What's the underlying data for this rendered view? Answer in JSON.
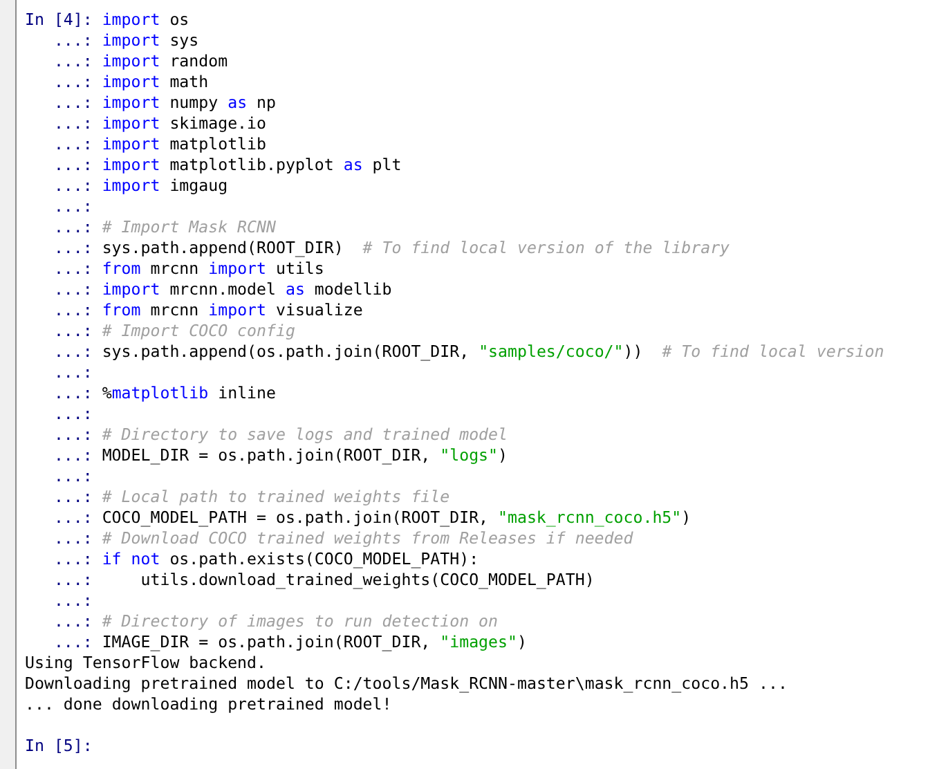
{
  "console": {
    "lines": [
      {
        "prompt": "In [4]:",
        "tokens": [
          {
            "kind": "keyword",
            "text": "import"
          },
          {
            "kind": "plain",
            "text": " os"
          }
        ]
      },
      {
        "prompt": "...:",
        "tokens": [
          {
            "kind": "keyword",
            "text": "import"
          },
          {
            "kind": "plain",
            "text": " sys"
          }
        ]
      },
      {
        "prompt": "...:",
        "tokens": [
          {
            "kind": "keyword",
            "text": "import"
          },
          {
            "kind": "plain",
            "text": " random"
          }
        ]
      },
      {
        "prompt": "...:",
        "tokens": [
          {
            "kind": "keyword",
            "text": "import"
          },
          {
            "kind": "plain",
            "text": " math"
          }
        ]
      },
      {
        "prompt": "...:",
        "tokens": [
          {
            "kind": "keyword",
            "text": "import"
          },
          {
            "kind": "plain",
            "text": " numpy "
          },
          {
            "kind": "keyword",
            "text": "as"
          },
          {
            "kind": "plain",
            "text": " np"
          }
        ]
      },
      {
        "prompt": "...:",
        "tokens": [
          {
            "kind": "keyword",
            "text": "import"
          },
          {
            "kind": "plain",
            "text": " skimage.io"
          }
        ]
      },
      {
        "prompt": "...:",
        "tokens": [
          {
            "kind": "keyword",
            "text": "import"
          },
          {
            "kind": "plain",
            "text": " matplotlib"
          }
        ]
      },
      {
        "prompt": "...:",
        "tokens": [
          {
            "kind": "keyword",
            "text": "import"
          },
          {
            "kind": "plain",
            "text": " matplotlib.pyplot "
          },
          {
            "kind": "keyword",
            "text": "as"
          },
          {
            "kind": "plain",
            "text": " plt"
          }
        ]
      },
      {
        "prompt": "...:",
        "tokens": [
          {
            "kind": "keyword",
            "text": "import"
          },
          {
            "kind": "plain",
            "text": " imgaug"
          }
        ]
      },
      {
        "prompt": "...:"
      },
      {
        "prompt": "...:",
        "tokens": [
          {
            "kind": "comment",
            "text": "# Import Mask RCNN"
          }
        ]
      },
      {
        "prompt": "...:",
        "tokens": [
          {
            "kind": "plain",
            "text": "sys.path.append(ROOT_DIR)  "
          },
          {
            "kind": "comment",
            "text": "# To find local version of the library"
          }
        ]
      },
      {
        "prompt": "...:",
        "tokens": [
          {
            "kind": "keyword",
            "text": "from"
          },
          {
            "kind": "plain",
            "text": " mrcnn "
          },
          {
            "kind": "keyword",
            "text": "import"
          },
          {
            "kind": "plain",
            "text": " utils"
          }
        ]
      },
      {
        "prompt": "...:",
        "tokens": [
          {
            "kind": "keyword",
            "text": "import"
          },
          {
            "kind": "plain",
            "text": " mrcnn.model "
          },
          {
            "kind": "keyword",
            "text": "as"
          },
          {
            "kind": "plain",
            "text": " modellib"
          }
        ]
      },
      {
        "prompt": "...:",
        "tokens": [
          {
            "kind": "keyword",
            "text": "from"
          },
          {
            "kind": "plain",
            "text": " mrcnn "
          },
          {
            "kind": "keyword",
            "text": "import"
          },
          {
            "kind": "plain",
            "text": " visualize"
          }
        ]
      },
      {
        "prompt": "...:",
        "tokens": [
          {
            "kind": "comment",
            "text": "# Import COCO config"
          }
        ]
      },
      {
        "prompt": "...:",
        "tokens": [
          {
            "kind": "plain",
            "text": "sys.path.append(os.path.join(ROOT_DIR, "
          },
          {
            "kind": "string",
            "text": "\"samples/coco/\""
          },
          {
            "kind": "plain",
            "text": "))  "
          },
          {
            "kind": "comment",
            "text": "# To find local version"
          }
        ]
      },
      {
        "prompt": "...:"
      },
      {
        "prompt": "...:",
        "tokens": [
          {
            "kind": "plain",
            "text": "%"
          },
          {
            "kind": "keyword",
            "text": "matplotlib"
          },
          {
            "kind": "plain",
            "text": " inline"
          }
        ]
      },
      {
        "prompt": "...:"
      },
      {
        "prompt": "...:",
        "tokens": [
          {
            "kind": "comment",
            "text": "# Directory to save logs and trained model"
          }
        ]
      },
      {
        "prompt": "...:",
        "tokens": [
          {
            "kind": "plain",
            "text": "MODEL_DIR = os.path.join(ROOT_DIR, "
          },
          {
            "kind": "string",
            "text": "\"logs\""
          },
          {
            "kind": "plain",
            "text": ")"
          }
        ]
      },
      {
        "prompt": "...:"
      },
      {
        "prompt": "...:",
        "tokens": [
          {
            "kind": "comment",
            "text": "# Local path to trained weights file"
          }
        ]
      },
      {
        "prompt": "...:",
        "tokens": [
          {
            "kind": "plain",
            "text": "COCO_MODEL_PATH = os.path.join(ROOT_DIR, "
          },
          {
            "kind": "string",
            "text": "\"mask_rcnn_coco.h5\""
          },
          {
            "kind": "plain",
            "text": ")"
          }
        ]
      },
      {
        "prompt": "...:",
        "tokens": [
          {
            "kind": "comment",
            "text": "# Download COCO trained weights from Releases if needed"
          }
        ]
      },
      {
        "prompt": "...:",
        "tokens": [
          {
            "kind": "keyword",
            "text": "if"
          },
          {
            "kind": "keyword",
            "text": " not"
          },
          {
            "kind": "plain",
            "text": " os.path.exists(COCO_MODEL_PATH):"
          }
        ]
      },
      {
        "prompt": "...:",
        "tokens": [
          {
            "kind": "plain",
            "text": "    utils.download_trained_weights(COCO_MODEL_PATH)"
          }
        ]
      },
      {
        "prompt": "...:"
      },
      {
        "prompt": "...:",
        "tokens": [
          {
            "kind": "comment",
            "text": "# Directory of images to run detection on"
          }
        ]
      },
      {
        "prompt": "...:",
        "tokens": [
          {
            "kind": "plain",
            "text": "IMAGE_DIR = os.path.join(ROOT_DIR, "
          },
          {
            "kind": "string",
            "text": "\"images\""
          },
          {
            "kind": "plain",
            "text": ")"
          }
        ]
      }
    ],
    "output": [
      "Using TensorFlow backend.",
      "Downloading pretrained model to C:/tools/Mask_RCNN-master\\mask_rcnn_coco.h5 ...",
      "... done downloading pretrained model!"
    ],
    "next_prompt": "In [5]:"
  }
}
